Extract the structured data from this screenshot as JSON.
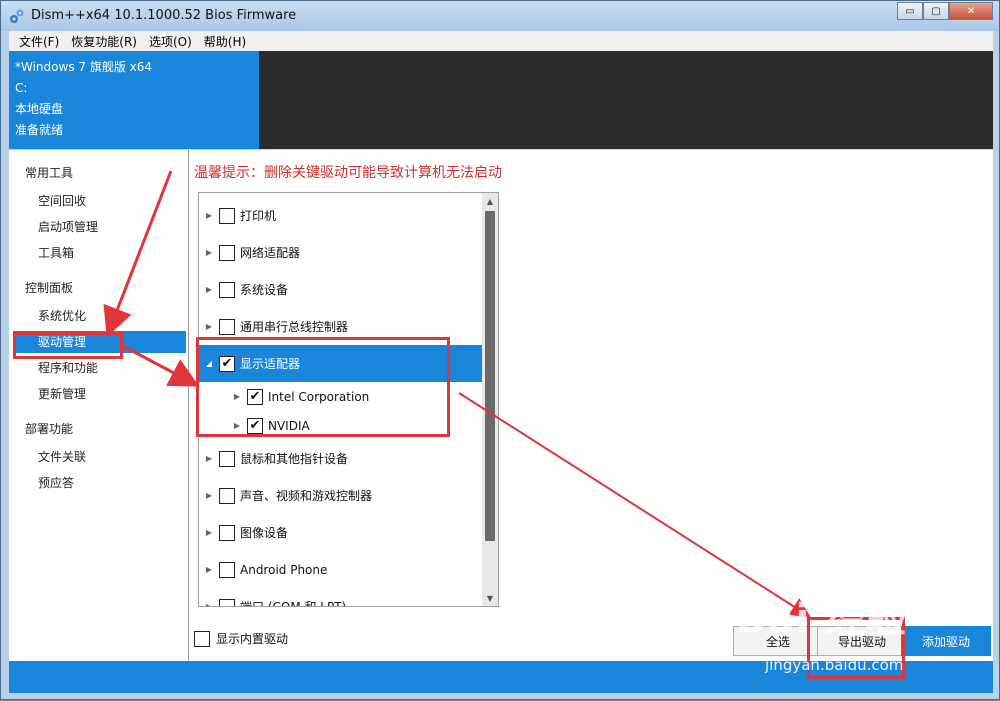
{
  "window": {
    "title": "Dism++x64 10.1.1000.52 Bios Firmware",
    "minimize_glyph": "▭",
    "maximize_glyph": "▢",
    "close_glyph": "✕"
  },
  "menubar": {
    "items": [
      "文件(F)",
      "恢复功能(R)",
      "选项(O)",
      "帮助(H)"
    ]
  },
  "info": {
    "os_name": "*Windows 7 旗舰版 x64",
    "drive": "C:",
    "disk_type": "本地硬盘",
    "status": "准备就绪"
  },
  "sidebar": {
    "groups": [
      {
        "label": "常用工具",
        "items": [
          "空间回收",
          "启动项管理",
          "工具箱"
        ]
      },
      {
        "label": "控制面板",
        "items": [
          "系统优化",
          "驱动管理",
          "程序和功能",
          "更新管理"
        ]
      },
      {
        "label": "部署功能",
        "items": [
          "文件关联",
          "预应答"
        ]
      }
    ],
    "active_item": "驱动管理"
  },
  "main": {
    "warning": "温馨提示：删除关键驱动可能导致计算机无法启动",
    "tree": [
      {
        "label": "打印机",
        "checked": false,
        "level": 0
      },
      {
        "label": "网络适配器",
        "checked": false,
        "level": 0
      },
      {
        "label": "系统设备",
        "checked": false,
        "level": 0
      },
      {
        "label": "通用串行总线控制器",
        "checked": false,
        "level": 0
      },
      {
        "label": "显示适配器",
        "checked": true,
        "level": 0,
        "selected": true,
        "expanded": true
      },
      {
        "label": "Intel Corporation",
        "checked": true,
        "level": 1
      },
      {
        "label": "NVIDIA",
        "checked": true,
        "level": 1
      },
      {
        "label": "鼠标和其他指针设备",
        "checked": false,
        "level": 0
      },
      {
        "label": "声音、视频和游戏控制器",
        "checked": false,
        "level": 0
      },
      {
        "label": "图像设备",
        "checked": false,
        "level": 0
      },
      {
        "label": "Android Phone",
        "checked": false,
        "level": 0
      },
      {
        "label": "端口 (COM 和 LPT)",
        "checked": false,
        "level": 0
      }
    ],
    "show_builtin_label": "显示内置驱动",
    "show_builtin_checked": false
  },
  "buttons": {
    "select_all": "全选",
    "export": "导出驱动",
    "add": "添加驱动"
  },
  "watermark": {
    "text": "Bai 经验",
    "url": "jingyan.baidu.com"
  },
  "colors": {
    "accent": "#1a86d9",
    "warning": "#d0302c",
    "annotation": "#e0353a"
  }
}
